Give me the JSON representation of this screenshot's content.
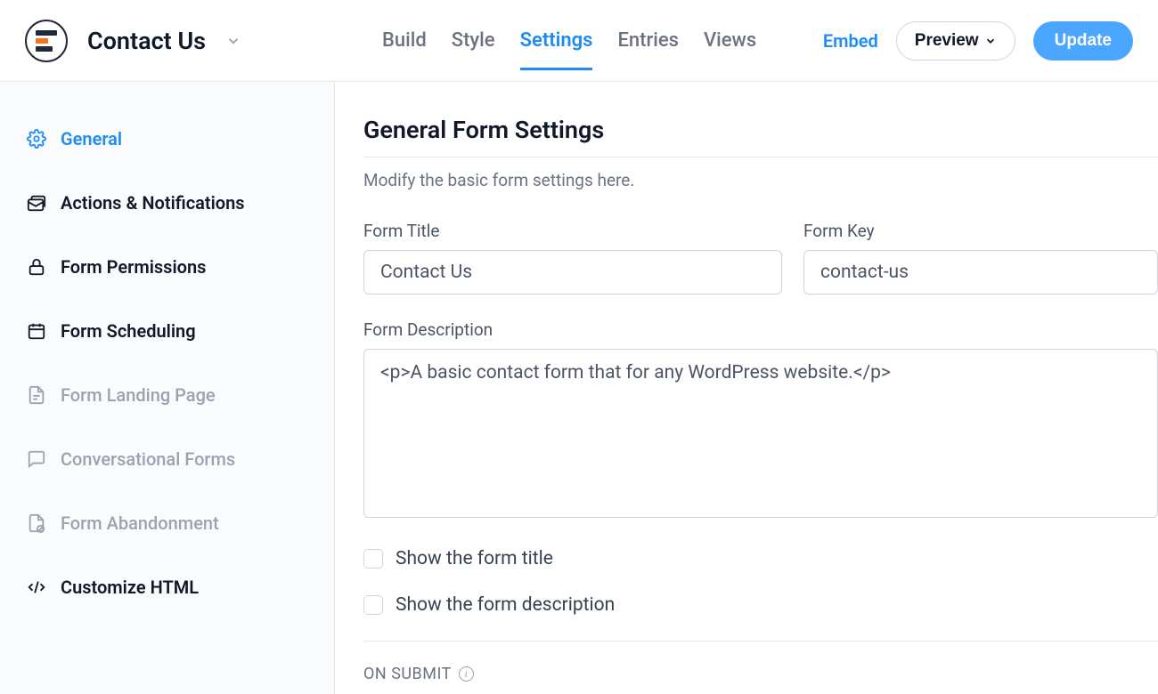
{
  "header": {
    "form_name": "Contact Us",
    "tabs": {
      "build": "Build",
      "style": "Style",
      "settings": "Settings",
      "entries": "Entries",
      "views": "Views"
    },
    "embed_label": "Embed",
    "preview_label": "Preview",
    "update_label": "Update"
  },
  "sidebar": {
    "general": "General",
    "actions": "Actions & Notifications",
    "permissions": "Form Permissions",
    "scheduling": "Form Scheduling",
    "landing": "Form Landing Page",
    "conversational": "Conversational Forms",
    "abandonment": "Form Abandonment",
    "customize_html": "Customize HTML"
  },
  "main": {
    "section_title": "General Form Settings",
    "section_desc": "Modify the basic form settings here.",
    "form_title_label": "Form Title",
    "form_title_value": "Contact Us",
    "form_key_label": "Form Key",
    "form_key_value": "contact-us",
    "form_description_label": "Form Description",
    "form_description_value": "<p>A basic contact form that for any WordPress website.</p>",
    "show_title_label": "Show the form title",
    "show_description_label": "Show the form description",
    "on_submit_label": "ON SUBMIT"
  }
}
